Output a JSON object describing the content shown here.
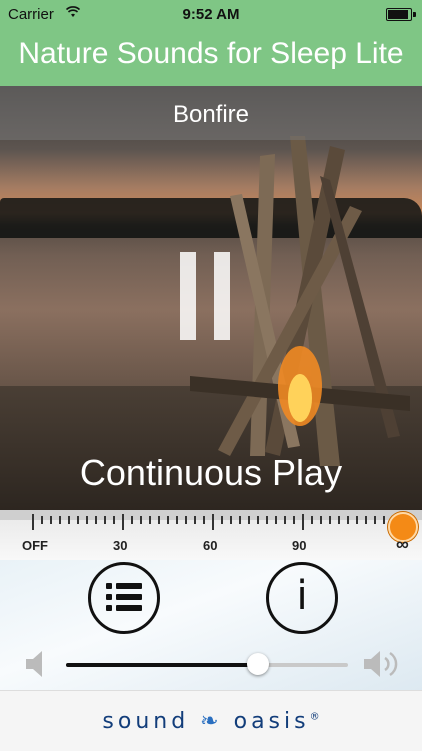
{
  "status_bar": {
    "carrier": "Carrier",
    "time": "9:52 AM"
  },
  "header": {
    "title": "Nature Sounds for Sleep Lite"
  },
  "player": {
    "sound_name": "Bonfire",
    "playback_state": "playing",
    "mode_label": "Continuous Play"
  },
  "timer": {
    "labels": [
      "OFF",
      "30",
      "60",
      "90"
    ],
    "infinity_label": "∞",
    "selected": "∞"
  },
  "controls": {
    "list_icon": "list-icon",
    "info_icon": "info-icon",
    "info_glyph": "i"
  },
  "volume": {
    "level": 0.68
  },
  "footer": {
    "brand_left": "sound",
    "brand_right": "oasis",
    "registered": "®"
  }
}
